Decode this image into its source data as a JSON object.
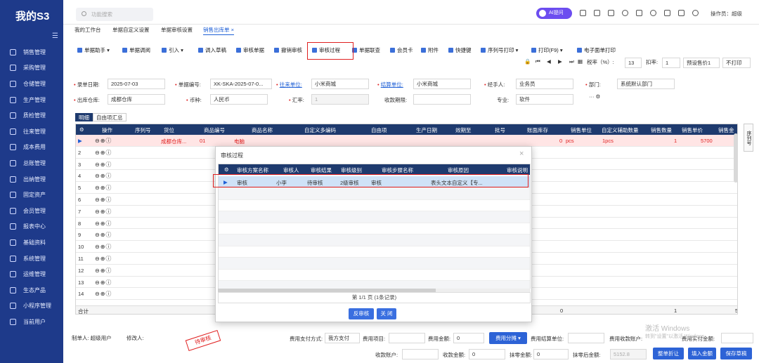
{
  "app": {
    "name": "我的S3",
    "collapse_icon": "collapse-icon"
  },
  "sidebar": {
    "items": [
      {
        "label": "销售管理",
        "icon": "sales-icon"
      },
      {
        "label": "采购管理",
        "icon": "cart-icon"
      },
      {
        "label": "仓储管理",
        "icon": "warehouse-icon"
      },
      {
        "label": "生产管理",
        "icon": "production-icon"
      },
      {
        "label": "质检管理",
        "icon": "quality-icon"
      },
      {
        "label": "往来管理",
        "icon": "exchange-icon"
      },
      {
        "label": "成本费用",
        "icon": "cost-icon"
      },
      {
        "label": "总账管理",
        "icon": "ledger-icon"
      },
      {
        "label": "出纳管理",
        "icon": "cashier-icon"
      },
      {
        "label": "固定资产",
        "icon": "asset-icon"
      },
      {
        "label": "会员管理",
        "icon": "member-icon"
      },
      {
        "label": "报表中心",
        "icon": "report-icon"
      },
      {
        "label": "基础资料",
        "icon": "base-data-icon"
      },
      {
        "label": "系统管理",
        "icon": "system-icon"
      },
      {
        "label": "运维管理",
        "icon": "ops-icon"
      },
      {
        "label": "生态产品",
        "icon": "eco-icon"
      },
      {
        "label": "小程序管理",
        "icon": "miniapp-icon"
      },
      {
        "label": "当前用户",
        "icon": "user-icon"
      }
    ]
  },
  "topbar": {
    "search_placeholder": "功能搜索",
    "ai_label": "AI提问",
    "operator": "操作员：超级"
  },
  "tabs": [
    {
      "label": "我的工作台"
    },
    {
      "label": "单据自定义设置"
    },
    {
      "label": "单据审核设置"
    },
    {
      "label": "销售出库单 ×",
      "active": true
    }
  ],
  "toolbar": {
    "items": [
      "单据助手 ▾",
      "单据调阅",
      "引入 ▾",
      "调入草稿",
      "审核单据",
      "撤销审核",
      "审核过程",
      "单据联查",
      "会员卡",
      "附件",
      "快捷键",
      "序列号打印 ▾",
      "打印(F9) ▾",
      "电子面单打印"
    ]
  },
  "toolbar2": {
    "tax_label": "税率（%）:",
    "tax_value": "13",
    "discount_label": "扣率:",
    "discount_value": "1",
    "price_select": "预设售价1",
    "print_select": "不打印"
  },
  "form": {
    "date_label": "录单日期:",
    "date_value": "2025-07-03",
    "doc_label": "单据编号:",
    "doc_value": "XK-SKA-2025-07-0...",
    "partner_label": "往来单位:",
    "partner_value": "小米商城",
    "settle_label": "结算单位:",
    "settle_value": "小米商城",
    "handler_label": "经手人:",
    "handler_value": "业务员",
    "dept_label": "部门:",
    "dept_value": "系统默认部门",
    "warehouse_label": "出库仓库:",
    "warehouse_value": "成都仓库",
    "currency_label": "币种:",
    "currency_value": "人民币",
    "rate_label": "汇率:",
    "rate_value": "1",
    "due_label": "收款期限:",
    "due_value": "",
    "major_label": "专业:",
    "major_value": "软件"
  },
  "detail_tabs": [
    "明细",
    "自由项汇总"
  ],
  "grid": {
    "columns": [
      "操作",
      "序列号",
      "货位",
      "商品编号",
      "商品名称",
      "自定义多编码",
      "自由项",
      "生产日期",
      "效期至",
      "批号",
      "账面库存",
      "销售单位",
      "自定义辅助数量",
      "销售数量",
      "销售单价",
      "销售金"
    ],
    "first_row": {
      "location": "成都仓库...",
      "code": "01",
      "name": "电脑",
      "stock": "0",
      "unit": "pcs",
      "aux_qty": "1pcs",
      "qty": "1",
      "price": "5700"
    },
    "row_numbers": [
      "▶",
      "2",
      "3",
      "4",
      "5",
      "6",
      "7",
      "8",
      "9",
      "10",
      "11",
      "12",
      "13",
      "14"
    ],
    "ops_symbols": "⊖⊕ⓘ",
    "total_label": "合计",
    "total_stock": "0",
    "total_qty": "1",
    "total_amount": "5"
  },
  "side_tab": "序列号",
  "modal": {
    "title": "审核过程",
    "columns": [
      "审核方案名称",
      "审核人",
      "审核结果",
      "审核级别",
      "审核步骤名称",
      "审核原因",
      "审核说明"
    ],
    "row": {
      "plan": "审核",
      "auditor": "小李",
      "result": "待审核",
      "level": "2级审核",
      "step": "审核",
      "reason": "表头文本自定义【专...",
      "note": ""
    },
    "pager": "第 1/1 页 (1条记录)",
    "buttons": [
      "反审核",
      "关 闭"
    ]
  },
  "footer": {
    "maker": "制单人:  超级用户",
    "modifier": "修改人:",
    "stamp": "待审核",
    "pay_method_label": "费用支付方式:",
    "pay_method_value": "我方支付",
    "fee_item_label": "费用项目:",
    "fee_amount_label": "费用金额:",
    "fee_amount_value": "0",
    "fee_split": "费用分摊 ▾",
    "fee_settle_label": "费用结算单位:",
    "fee_account_label": "费用收款账户:",
    "actual_label": "费用实付金额:",
    "receive_account_label": "收款账户:",
    "receive_amount_label": "收款金额:",
    "receive_amount_value": "0",
    "wipe_label": "抹零金额:",
    "wipe_value": "0",
    "after_wipe_label": "抹零后金额:",
    "after_wipe_value": "5152.8",
    "buttons": [
      "整单折让",
      "填入金额",
      "保存草稿"
    ]
  },
  "watermark": {
    "line1": "激活 Windows",
    "line2": "转到\"设置\"以激活 Windows。"
  }
}
